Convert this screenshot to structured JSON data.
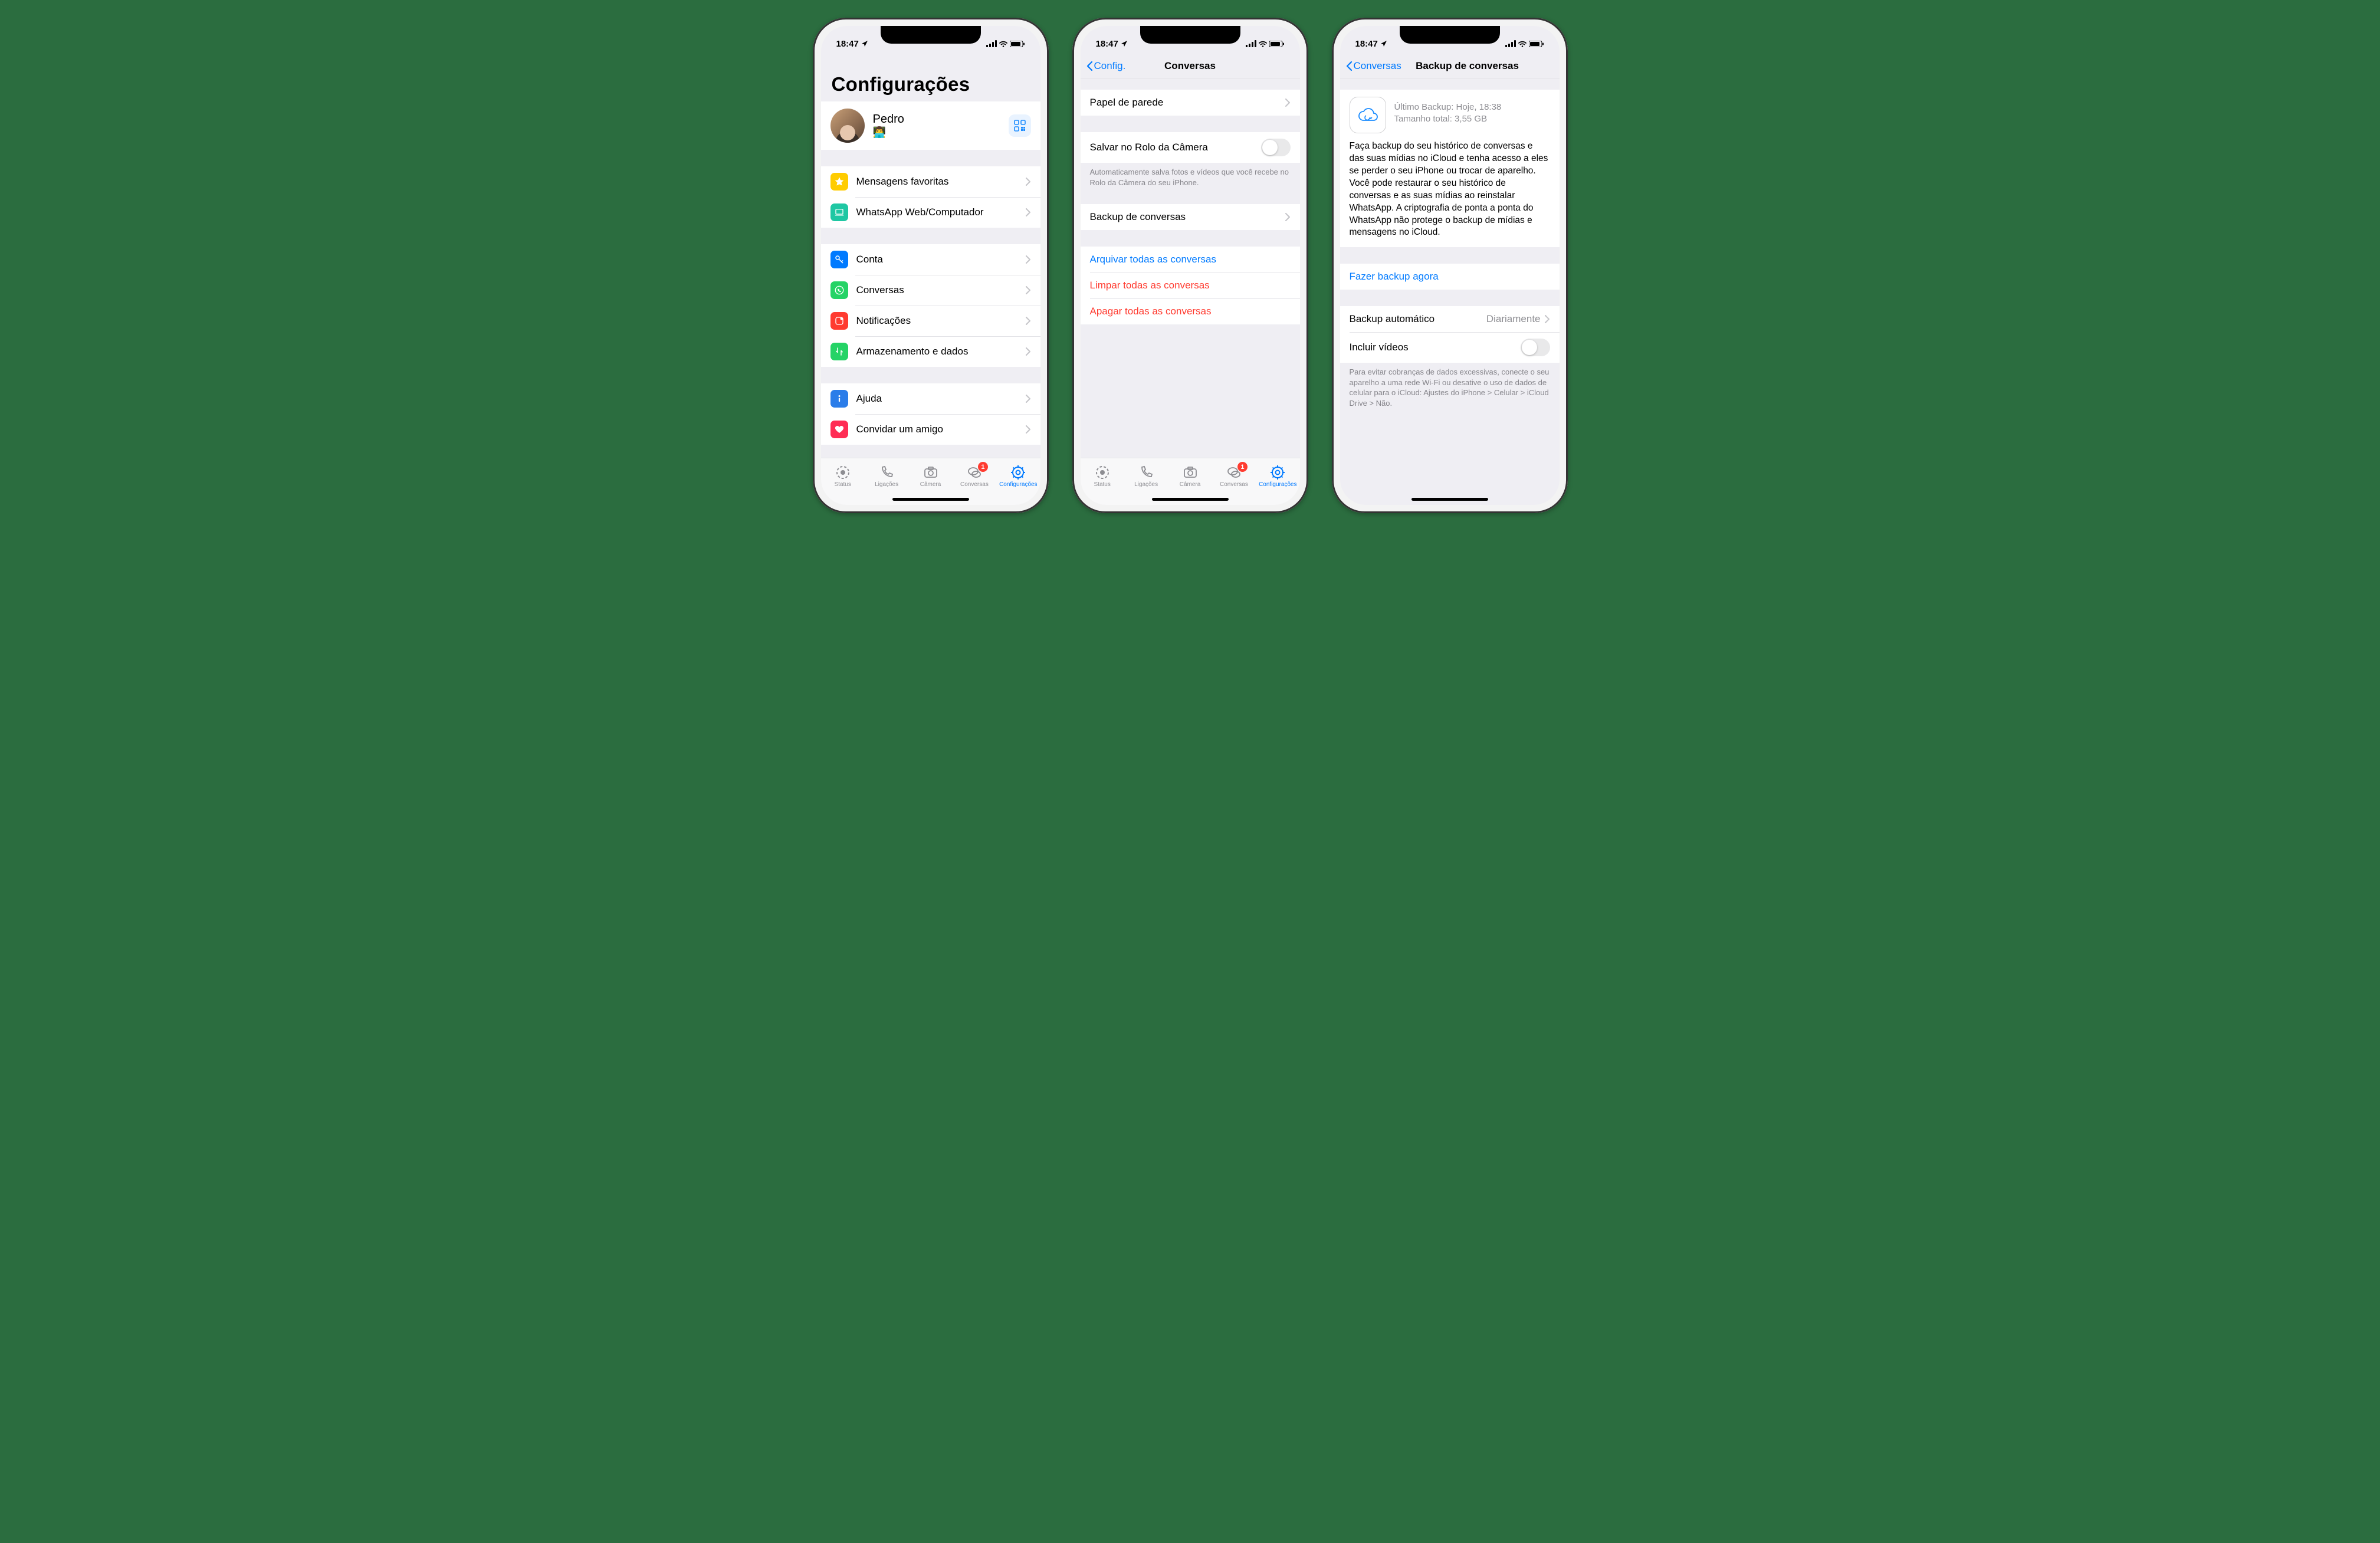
{
  "status": {
    "time": "18:47"
  },
  "phone1": {
    "title": "Configurações",
    "profile": {
      "name": "Pedro",
      "status_emoji": "👨‍💻"
    },
    "group1": [
      {
        "label": "Mensagens favoritas"
      },
      {
        "label": "WhatsApp Web/Computador"
      }
    ],
    "group2": [
      {
        "label": "Conta"
      },
      {
        "label": "Conversas"
      },
      {
        "label": "Notificações"
      },
      {
        "label": "Armazenamento e dados"
      }
    ],
    "group3": [
      {
        "label": "Ajuda"
      },
      {
        "label": "Convidar um amigo"
      }
    ]
  },
  "phone2": {
    "back_label": "Config.",
    "title": "Conversas",
    "row_wallpaper": "Papel de parede",
    "row_camera_roll": "Salvar no Rolo da Câmera",
    "footer_camera_roll": "Automaticamente salva fotos e vídeos que você recebe no Rolo da Câmera do seu iPhone.",
    "row_backup": "Backup de conversas",
    "row_archive": "Arquivar todas as conversas",
    "row_clear": "Limpar todas as conversas",
    "row_delete": "Apagar todas as conversas"
  },
  "phone3": {
    "back_label": "Conversas",
    "title": "Backup de conversas",
    "last_backup_label": "Último Backup: Hoje, 18:38",
    "total_size_label": "Tamanho total: 3,55 GB",
    "description": "Faça backup do seu histórico de conversas e das suas mídias no iCloud e tenha acesso a eles se perder o seu iPhone ou trocar de aparelho. Você pode restaurar o seu histórico de conversas e as suas mídias ao reinstalar WhatsApp. A criptografia de ponta a ponta do WhatsApp não protege o backup de mídias e mensagens no iCloud.",
    "row_backup_now": "Fazer backup agora",
    "row_auto_backup": "Backup automático",
    "row_auto_backup_value": "Diariamente",
    "row_include_videos": "Incluir vídeos",
    "footer_data": "Para evitar cobranças de dados excessivas, conecte o seu aparelho a uma rede Wi-Fi ou desative o uso de dados de celular para o iCloud: Ajustes do iPhone > Celular > iCloud Drive > Não."
  },
  "tabs": {
    "status": "Status",
    "calls": "Ligações",
    "camera": "Câmera",
    "chats": "Conversas",
    "chats_badge": "1",
    "settings": "Configurações"
  }
}
